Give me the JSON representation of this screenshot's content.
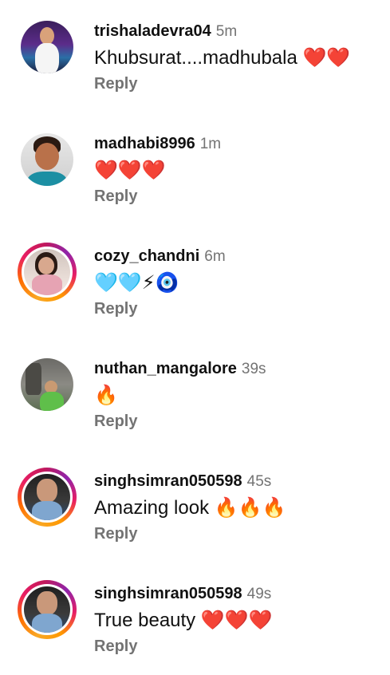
{
  "comments": [
    {
      "username": "trishaladevra04",
      "time": "5m",
      "text": "Khubsurat....madhubala ❤️❤️",
      "reply": "Reply",
      "story": false,
      "avatar": "avatar-woman-purple"
    },
    {
      "username": "madhabi8996",
      "time": "1m",
      "text": "❤️❤️❤️",
      "reply": "Reply",
      "story": false,
      "avatar": "avatar-woman-smiling"
    },
    {
      "username": "cozy_chandni",
      "time": "6m",
      "text": "🩵🩵⚡🧿",
      "reply": "Reply",
      "story": true,
      "avatar": "avatar-woman-pink"
    },
    {
      "username": "nuthan_mangalore",
      "time": "39s",
      "text": "🔥",
      "reply": "Reply",
      "story": false,
      "avatar": "avatar-man-street"
    },
    {
      "username": "singhsimran050598",
      "time": "45s",
      "text": "Amazing look 🔥🔥🔥",
      "reply": "Reply",
      "story": true,
      "avatar": "avatar-woman-jeans"
    },
    {
      "username": "singhsimran050598",
      "time": "49s",
      "text": "True beauty ❤️❤️❤️",
      "reply": "Reply",
      "story": true,
      "avatar": "avatar-woman-jeans"
    }
  ]
}
